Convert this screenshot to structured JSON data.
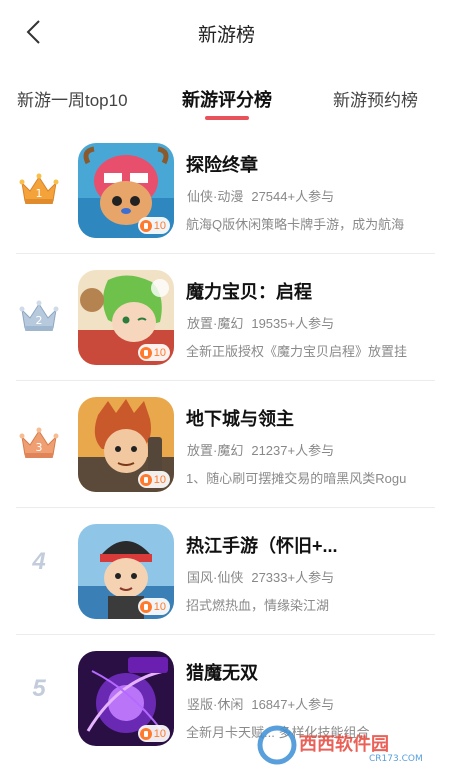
{
  "header": {
    "title": "新游榜",
    "back_icon": "back-chevron-icon"
  },
  "tabs": [
    {
      "label": "新游一周top10",
      "active": false
    },
    {
      "label": "新游评分榜",
      "active": true
    },
    {
      "label": "新游预约榜",
      "active": false
    }
  ],
  "colors": {
    "accent": "#e8525a",
    "score": "#ff7a2d",
    "rank_gold": "#f4a23a",
    "rank_silver": "#9fb6cf",
    "rank_bronze": "#e69c6a"
  },
  "games": [
    {
      "rank": "1",
      "rank_style": "crown-gold",
      "name": "探险终章",
      "tags": "仙侠·动漫",
      "players": "27544+人参与",
      "desc": "航海Q版休闲策略卡牌手游，成为航海",
      "score": "10"
    },
    {
      "rank": "2",
      "rank_style": "crown-silver",
      "name": "魔力宝贝：启程",
      "tags": "放置·魔幻",
      "players": "19535+人参与",
      "desc": "全新正版授权《魔力宝贝启程》放置挂",
      "score": "10"
    },
    {
      "rank": "3",
      "rank_style": "crown-bronze",
      "name": "地下城与领主",
      "tags": "放置·魔幻",
      "players": "21237+人参与",
      "desc": "1、随心刷可摆摊交易的暗黑风类Rogu",
      "score": "10"
    },
    {
      "rank": "4",
      "rank_style": "number",
      "name": "热江手游（怀旧+...",
      "tags": "国风·仙侠",
      "players": "27333+人参与",
      "desc": "招式燃热血，情缘染江湖",
      "score": "10"
    },
    {
      "rank": "5",
      "rank_style": "number",
      "name": "猎魔无双",
      "tags": "竖版·休闲",
      "players": "16847+人参与",
      "desc": "全新月卡天赋... 多样化技能组合",
      "score": "10"
    }
  ],
  "watermark": {
    "text": "西西软件园",
    "sub": "CR173.COM"
  }
}
